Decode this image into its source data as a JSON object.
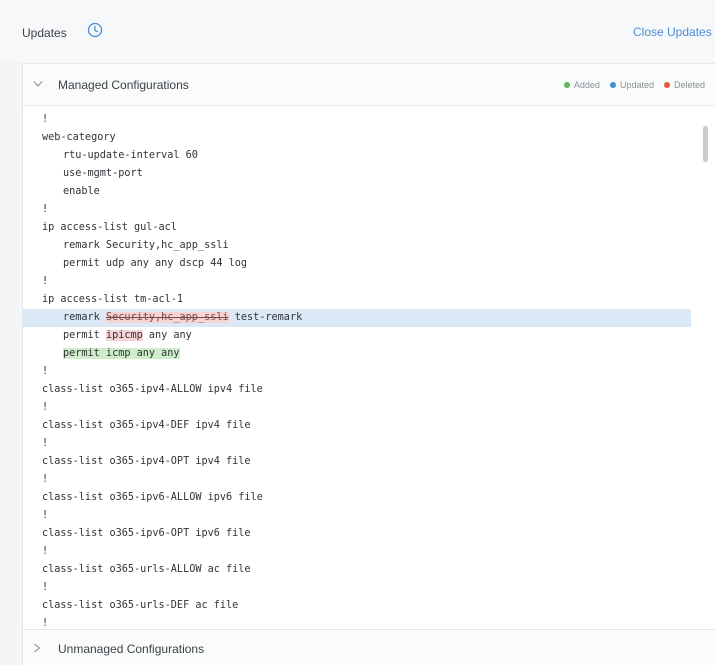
{
  "header": {
    "title": "Updates",
    "info_icon": "info-icon",
    "close_label": "Close Updates"
  },
  "managed": {
    "title": "Managed Configurations",
    "legend": [
      {
        "label": "Added",
        "color": "#5fb85a"
      },
      {
        "label": "Updated",
        "color": "#3d8fd6"
      },
      {
        "label": "Deleted",
        "color": "#e2573b"
      }
    ],
    "lines": [
      {
        "text": "!",
        "indent": false
      },
      {
        "text": "web-category",
        "indent": false
      },
      {
        "text": "rtu-update-interval 60",
        "indent": true
      },
      {
        "text": "use-mgmt-port",
        "indent": true
      },
      {
        "text": "enable",
        "indent": true
      },
      {
        "text": "!",
        "indent": false
      },
      {
        "text": "ip access-list gul-acl",
        "indent": false
      },
      {
        "text": "remark Security,hc_app_ssli",
        "indent": true
      },
      {
        "text": "permit udp any any dscp 44 log",
        "indent": true
      },
      {
        "text": "!",
        "indent": false
      },
      {
        "text": "ip access-list tm-acl-1",
        "indent": false
      },
      {
        "text": "",
        "indent": true,
        "kind": "updated"
      },
      {
        "text": "",
        "indent": true,
        "kind": "inline-delete"
      },
      {
        "text": "permit icmp any any",
        "indent": true,
        "kind": "added"
      },
      {
        "text": "!",
        "indent": false
      },
      {
        "text": "class-list o365-ipv4-ALLOW ipv4 file",
        "indent": false
      },
      {
        "text": "!",
        "indent": false
      },
      {
        "text": "class-list o365-ipv4-DEF ipv4 file",
        "indent": false
      },
      {
        "text": "!",
        "indent": false
      },
      {
        "text": "class-list o365-ipv4-OPT ipv4 file",
        "indent": false
      },
      {
        "text": "!",
        "indent": false
      },
      {
        "text": "class-list o365-ipv6-ALLOW ipv6 file",
        "indent": false
      },
      {
        "text": "!",
        "indent": false
      },
      {
        "text": "class-list o365-ipv6-OPT ipv6 file",
        "indent": false
      },
      {
        "text": "!",
        "indent": false
      },
      {
        "text": "class-list o365-urls-ALLOW ac file",
        "indent": false
      },
      {
        "text": "!",
        "indent": false
      },
      {
        "text": "class-list o365-urls-DEF ac file",
        "indent": false
      },
      {
        "text": "!",
        "indent": false
      }
    ],
    "updated_line": {
      "prefix": "remark ",
      "deleted": "Security,hc_app_ssli",
      "added": " test-remark"
    },
    "inline_delete_line": {
      "prefix": "permit ",
      "deleted": "ipicmp",
      "suffix": " any any"
    }
  },
  "unmanaged": {
    "title": "Unmanaged Configurations"
  }
}
